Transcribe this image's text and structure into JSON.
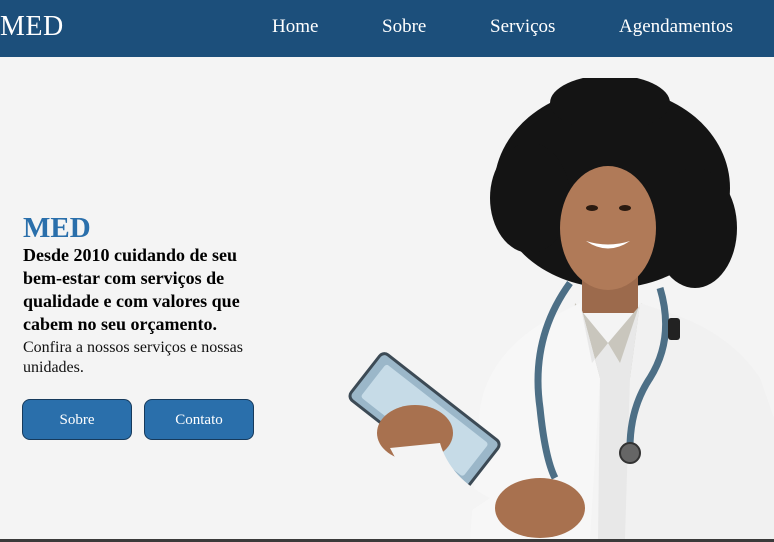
{
  "nav": {
    "logo": "MED",
    "links": [
      "Home",
      "Sobre",
      "Serviços",
      "Agendamentos"
    ]
  },
  "hero": {
    "brand": "MED",
    "headline": "Desde 2010 cuidando de seu bem-estar com serviços de qualidade e com valores que cabem no seu orçamento.",
    "subtext": "Confira a nossos serviços e nossas unidades.",
    "buttons": [
      "Sobre",
      "Contato"
    ]
  },
  "colors": {
    "navbar": "#1c4f7b",
    "accent": "#2a6fab",
    "background": "#f4f4f4"
  }
}
